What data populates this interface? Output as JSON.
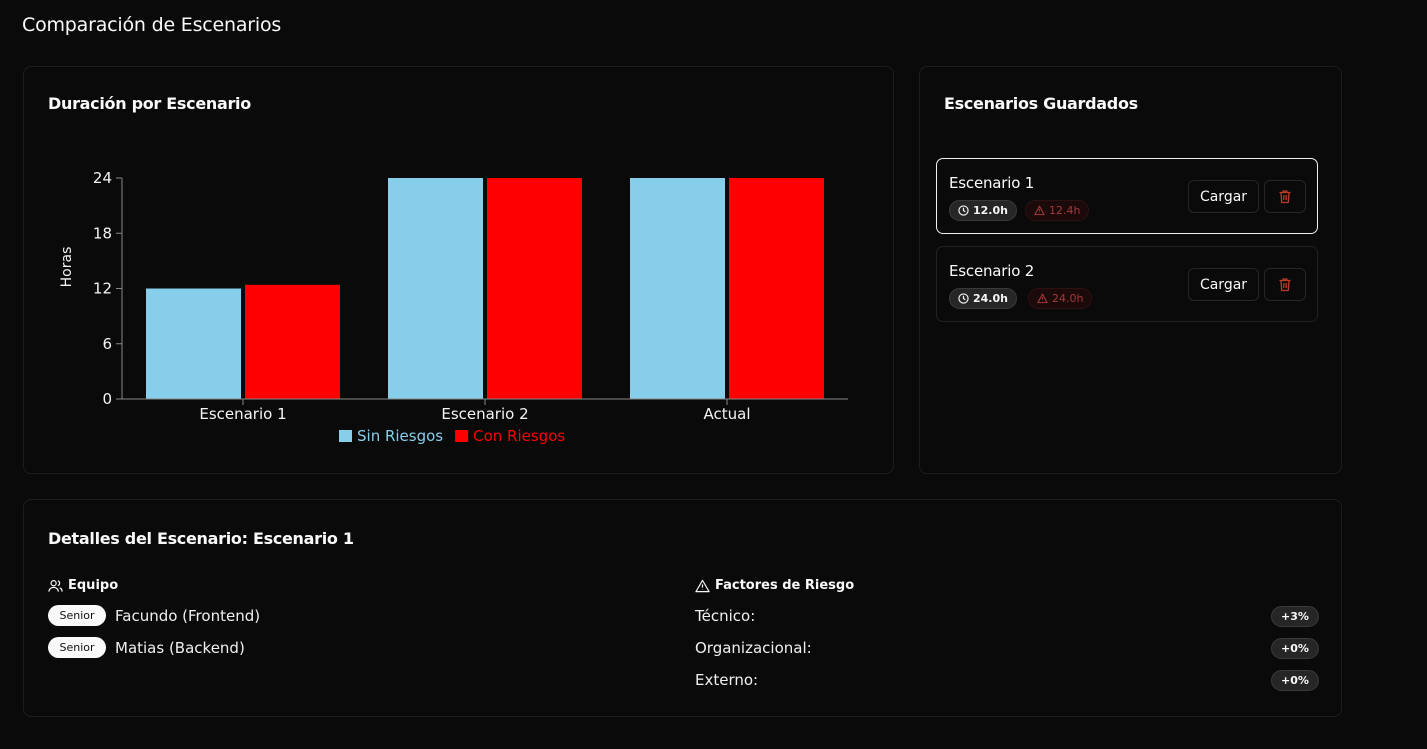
{
  "page": {
    "title": "Comparación de Escenarios"
  },
  "chart_card": {
    "title": "Duración por Escenario"
  },
  "chart_data": {
    "type": "bar",
    "categories": [
      "Escenario 1",
      "Escenario 2",
      "Actual"
    ],
    "series": [
      {
        "name": "Sin Riesgos",
        "color": "#87ceeb",
        "values": [
          12,
          24,
          24
        ]
      },
      {
        "name": "Con Riesgos",
        "color": "#ff0000",
        "values": [
          12.4,
          24,
          24
        ]
      }
    ],
    "ylabel": "Horas",
    "xlabel": "",
    "ylim": [
      0,
      24
    ],
    "yticks": [
      "0",
      "6",
      "12",
      "18",
      "24"
    ],
    "legend": "bottom"
  },
  "saved_card": {
    "title": "Escenarios Guardados",
    "scenarios": [
      {
        "name": "Escenario 1",
        "time": "12.0h",
        "risk_time": "12.4h",
        "load_label": "Cargar"
      },
      {
        "name": "Escenario 2",
        "time": "24.0h",
        "risk_time": "24.0h",
        "load_label": "Cargar"
      }
    ]
  },
  "details": {
    "title": "Detalles del Escenario: Escenario 1",
    "team_label": "Equipo",
    "team": [
      {
        "level": "Senior",
        "name": "Facundo (Frontend)"
      },
      {
        "level": "Senior",
        "name": "Matias (Backend)"
      }
    ],
    "risk_label": "Factores de Riesgo",
    "risks": [
      {
        "label": "Técnico:",
        "value": "+3%"
      },
      {
        "label": "Organizacional:",
        "value": "+0%"
      },
      {
        "label": "Externo:",
        "value": "+0%"
      }
    ]
  }
}
